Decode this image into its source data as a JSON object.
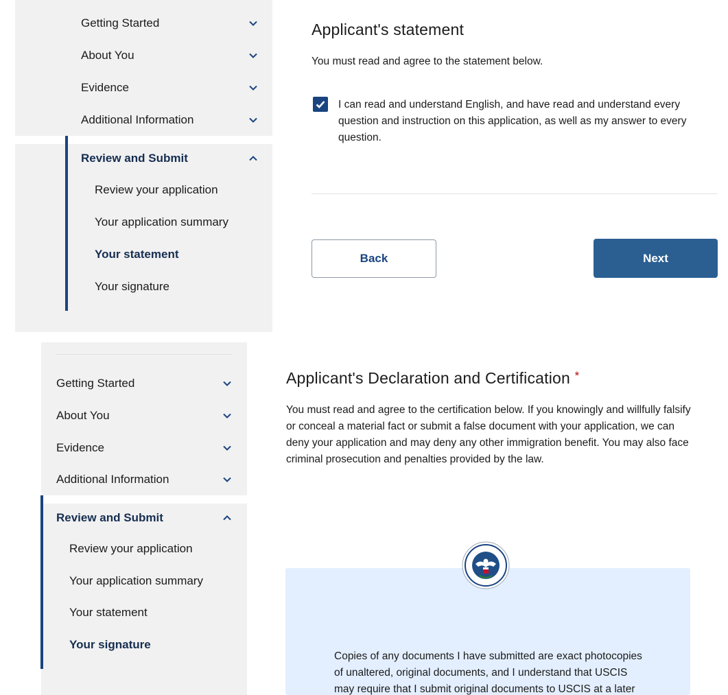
{
  "top": {
    "sidebar": {
      "items": [
        {
          "label": "Getting Started"
        },
        {
          "label": "About You"
        },
        {
          "label": "Evidence"
        },
        {
          "label": "Additional Information"
        }
      ],
      "active_section": "Review and Submit",
      "sub_items": [
        {
          "label": "Review your application"
        },
        {
          "label": "Your application summary"
        },
        {
          "label": "Your statement"
        },
        {
          "label": "Your signature"
        }
      ],
      "current_sub_index": 2
    },
    "main": {
      "title": "Applicant's statement",
      "instruction": "You must read and agree to the statement below.",
      "checkbox_checked": true,
      "checkbox_label": "I can read and understand English, and have read and understand every question and instruction on this application, as well as my answer to every question.",
      "back_label": "Back",
      "next_label": "Next"
    }
  },
  "bottom": {
    "sidebar": {
      "items": [
        {
          "label": "Getting Started"
        },
        {
          "label": "About You"
        },
        {
          "label": "Evidence"
        },
        {
          "label": "Additional Information"
        }
      ],
      "active_section": "Review and Submit",
      "sub_items": [
        {
          "label": "Review your application"
        },
        {
          "label": "Your application summary"
        },
        {
          "label": "Your statement"
        },
        {
          "label": "Your signature"
        }
      ],
      "current_sub_index": 3
    },
    "main": {
      "title": "Applicant's Declaration and Certification",
      "required_marker": "*",
      "instruction": "You must read and agree to the certification below. If you knowingly and willfully falsify or conceal a material fact or submit a false document with your application, we can deny your application and may deny any other immigration benefit. You may also face criminal prosecution and penalties provided by the law.",
      "seal_text": "U.S. DEPARTMENT OF HOMELAND SECURITY",
      "certification_text": "Copies of any documents I have submitted are exact photocopies of unaltered, original documents, and I understand that USCIS may require that I submit original documents to USCIS at a later date. Furthermore, I"
    }
  },
  "colors": {
    "accent": "#1a4480",
    "primary_button": "#2b5f92",
    "sidebar_bg": "#f1f1f1",
    "card_bg": "#e3efff",
    "required": "#b50909"
  },
  "icons": {
    "nav_collapsed": "chevron-down-icon",
    "nav_expanded": "chevron-up-icon",
    "checkbox": "checkmark-icon",
    "seal": "dhs-seal-icon"
  }
}
